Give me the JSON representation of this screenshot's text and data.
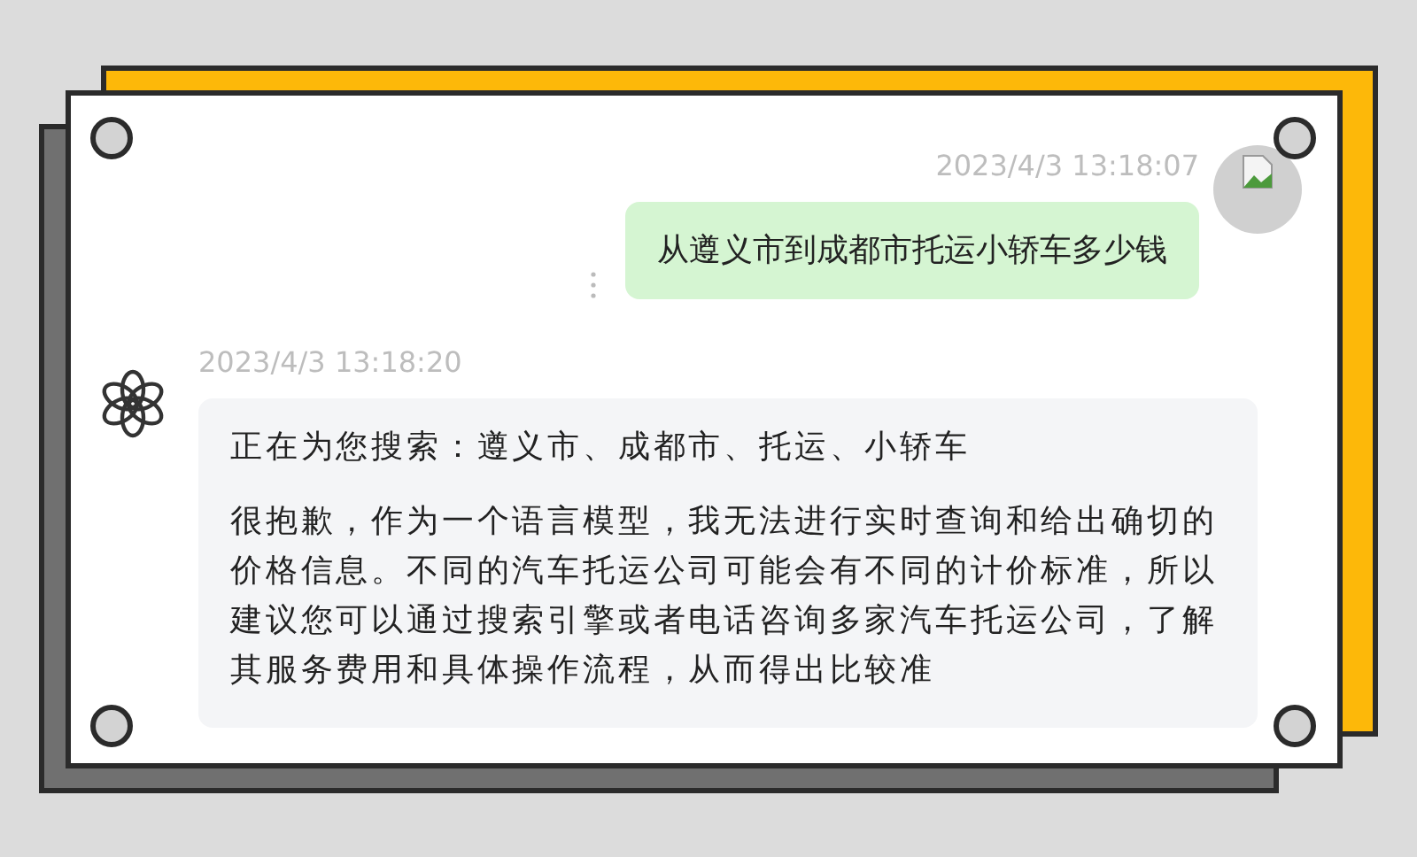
{
  "messages": [
    {
      "kind": "user",
      "time": "2023/4/3 13:18:07",
      "paragraphs": [
        "从遵义市到成都市托运小轿车多少钱"
      ]
    },
    {
      "kind": "assistant",
      "time": "2023/4/3 13:18:20",
      "paragraphs": [
        "正在为您搜索：遵义市、成都市、托运、小轿车",
        "很抱歉，作为一个语言模型，我无法进行实时查询和给出确切的价格信息。不同的汽车托运公司可能会有不同的计价标准，所以建议您可以通过搜索引擎或者电话咨询多家汽车托运公司，了解其服务费用和具体操作流程，从而得出比较准"
      ]
    }
  ]
}
